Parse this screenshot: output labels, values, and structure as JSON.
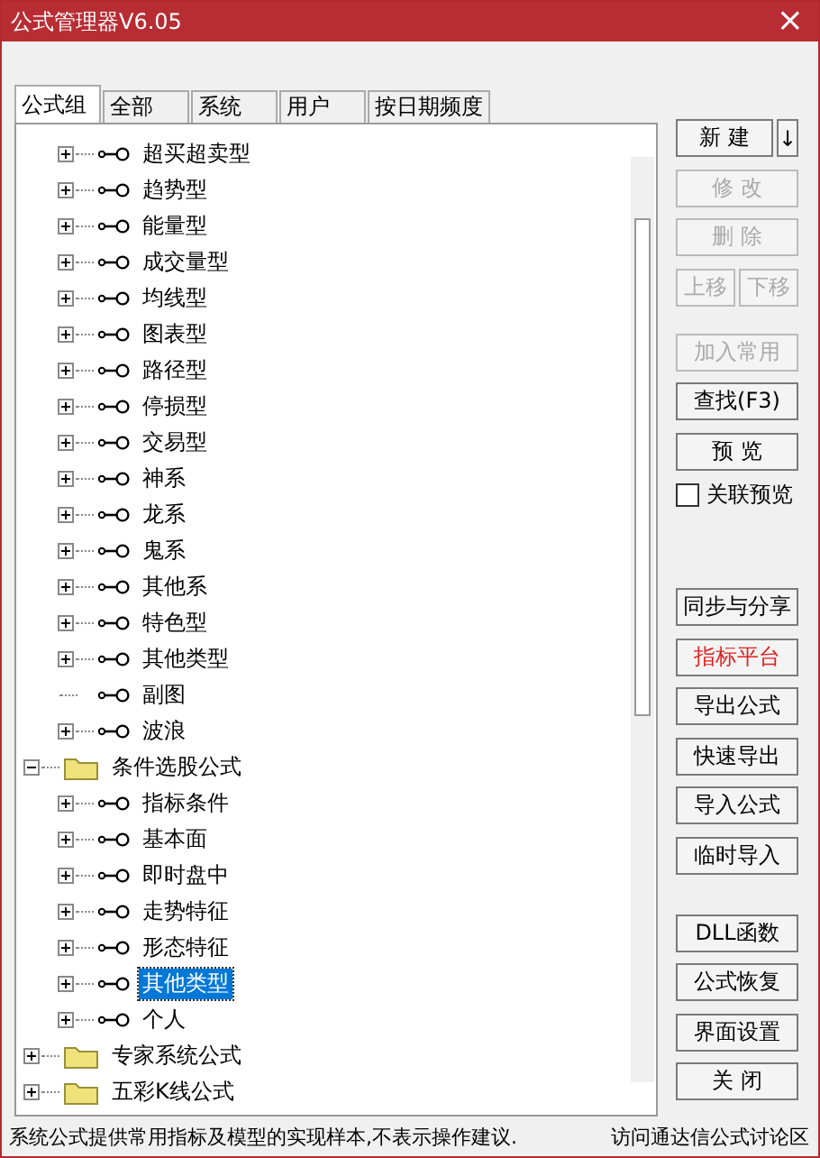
{
  "window": {
    "title": "公式管理器V6.05",
    "close": "×"
  },
  "tabs": [
    {
      "label": "公式组",
      "selected": true
    },
    {
      "label": "全部",
      "selected": false
    },
    {
      "label": "系统",
      "selected": false
    },
    {
      "label": "用户",
      "selected": false
    },
    {
      "label": "按日期频度",
      "selected": false
    }
  ],
  "tree": [
    {
      "kind": "partial",
      "children": [
        {
          "kind": "formula",
          "label": "超买超卖型",
          "expandable": true,
          "selected": false
        },
        {
          "kind": "formula",
          "label": "趋势型",
          "expandable": true,
          "selected": false
        },
        {
          "kind": "formula",
          "label": "能量型",
          "expandable": true,
          "selected": false
        },
        {
          "kind": "formula",
          "label": "成交量型",
          "expandable": true,
          "selected": false
        },
        {
          "kind": "formula",
          "label": "均线型",
          "expandable": true,
          "selected": false
        },
        {
          "kind": "formula",
          "label": "图表型",
          "expandable": true,
          "selected": false
        },
        {
          "kind": "formula",
          "label": "路径型",
          "expandable": true,
          "selected": false
        },
        {
          "kind": "formula",
          "label": "停损型",
          "expandable": true,
          "selected": false
        },
        {
          "kind": "formula",
          "label": "交易型",
          "expandable": true,
          "selected": false
        },
        {
          "kind": "formula",
          "label": "神系",
          "expandable": true,
          "selected": false
        },
        {
          "kind": "formula",
          "label": "龙系",
          "expandable": true,
          "selected": false
        },
        {
          "kind": "formula",
          "label": "鬼系",
          "expandable": true,
          "selected": false
        },
        {
          "kind": "formula",
          "label": "其他系",
          "expandable": true,
          "selected": false
        },
        {
          "kind": "formula",
          "label": "特色型",
          "expandable": true,
          "selected": false
        },
        {
          "kind": "formula",
          "label": "其他类型",
          "expandable": true,
          "selected": false
        },
        {
          "kind": "formula",
          "label": "副图",
          "expandable": false,
          "selected": false
        },
        {
          "kind": "formula",
          "label": "波浪",
          "expandable": true,
          "selected": false
        }
      ]
    },
    {
      "kind": "folder",
      "label": "条件选股公式",
      "expandable": true,
      "expanded": true,
      "selected": false,
      "children": [
        {
          "kind": "formula",
          "label": "指标条件",
          "expandable": true,
          "selected": false
        },
        {
          "kind": "formula",
          "label": "基本面",
          "expandable": true,
          "selected": false
        },
        {
          "kind": "formula",
          "label": "即时盘中",
          "expandable": true,
          "selected": false
        },
        {
          "kind": "formula",
          "label": "走势特征",
          "expandable": true,
          "selected": false
        },
        {
          "kind": "formula",
          "label": "形态特征",
          "expandable": true,
          "selected": false
        },
        {
          "kind": "formula",
          "label": "其他类型",
          "expandable": true,
          "selected": true
        },
        {
          "kind": "formula",
          "label": "个人",
          "expandable": true,
          "selected": false
        }
      ]
    },
    {
      "kind": "folder",
      "label": "专家系统公式",
      "expandable": true,
      "expanded": false,
      "selected": false
    },
    {
      "kind": "folder",
      "label": "五彩K线公式",
      "expandable": true,
      "expanded": false,
      "selected": false
    }
  ],
  "side": [
    {
      "items": [
        {
          "kind": "split",
          "label": "新 建",
          "arrow": "↓",
          "disabled": false
        },
        {
          "kind": "button",
          "label": "修 改",
          "disabled": true
        },
        {
          "kind": "button",
          "label": "删 除",
          "disabled": true
        },
        {
          "kind": "pair",
          "buttons": [
            {
              "label": "上移",
              "disabled": true
            },
            {
              "label": "下移",
              "disabled": true
            }
          ]
        }
      ]
    },
    {
      "items": [
        {
          "kind": "button",
          "label": "加入常用",
          "disabled": true
        },
        {
          "kind": "button",
          "label": "查找(F3)",
          "disabled": false
        },
        {
          "kind": "button",
          "label": "预 览",
          "disabled": false
        },
        {
          "kind": "checkbox",
          "label": "关联预览",
          "checked": false
        }
      ]
    },
    {
      "items": [
        {
          "kind": "button",
          "label": "同步与分享",
          "disabled": false
        },
        {
          "kind": "button",
          "label": "指标平台",
          "disabled": false,
          "accent": true
        },
        {
          "kind": "button",
          "label": "导出公式",
          "disabled": false
        },
        {
          "kind": "button",
          "label": "快速导出",
          "disabled": false
        },
        {
          "kind": "button",
          "label": "导入公式",
          "disabled": false
        },
        {
          "kind": "button",
          "label": "临时导入",
          "disabled": false
        }
      ]
    },
    {
      "items": [
        {
          "kind": "button",
          "label": "DLL函数",
          "disabled": false
        },
        {
          "kind": "button",
          "label": "公式恢复",
          "disabled": false
        },
        {
          "kind": "button",
          "label": "界面设置",
          "disabled": false
        },
        {
          "kind": "button",
          "label": "关 闭",
          "disabled": false
        }
      ]
    }
  ],
  "status_bar": {
    "text": "系统公式提供常用指标及模型的实现样本,不表示操作建议.",
    "link": "访问通达信公式讨论区"
  }
}
